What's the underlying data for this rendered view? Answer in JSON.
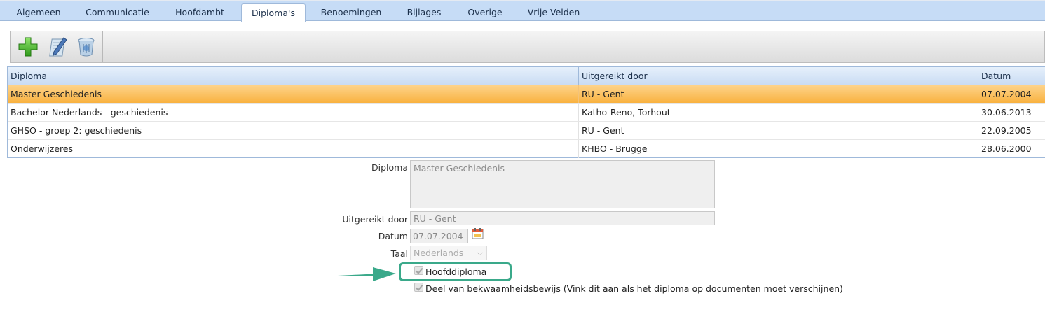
{
  "tabs": [
    {
      "label": "Algemeen"
    },
    {
      "label": "Communicatie"
    },
    {
      "label": "Hoofdambt"
    },
    {
      "label": "Diploma's"
    },
    {
      "label": "Benoemingen"
    },
    {
      "label": "Bijlages"
    },
    {
      "label": "Overige"
    },
    {
      "label": "Vrije Velden"
    }
  ],
  "active_tab": "Diploma's",
  "toolbar": {
    "icons": [
      "add-icon",
      "edit-icon",
      "delete-icon"
    ]
  },
  "grid": {
    "columns": [
      "Diploma",
      "Uitgereikt door",
      "Datum"
    ],
    "rows": [
      [
        "Master Geschiedenis",
        "RU - Gent",
        "07.07.2004"
      ],
      [
        "Bachelor Nederlands - geschiedenis",
        "Katho-Reno, Torhout",
        "30.06.2013"
      ],
      [
        "GHSO - groep 2: geschiedenis",
        "RU - Gent",
        "22.09.2005"
      ],
      [
        "Onderwijzeres",
        "KHBO - Brugge",
        "28.06.2000"
      ]
    ],
    "selected_row": 0
  },
  "form": {
    "diploma_label": "Diploma",
    "diploma_value": "Master Geschiedenis",
    "uitgereikt_label": "Uitgereikt door",
    "uitgereikt_value": "RU - Gent",
    "datum_label": "Datum",
    "datum_value": "07.07.2004",
    "taal_label": "Taal",
    "taal_value": "Nederlands",
    "hoofddiploma_label": "Hoofddiploma",
    "hoofddiploma_checked": true,
    "bekwaam_label": "Deel van bekwaamheidsbewijs (Vink dit aan als het diploma op documenten moet verschijnen)",
    "bekwaam_checked": true
  },
  "colors": {
    "tabbar": "#c6dcf6",
    "selected_row": "#f9b23f",
    "highlight": "#3aa98a",
    "arrow": "#3aa98a"
  }
}
